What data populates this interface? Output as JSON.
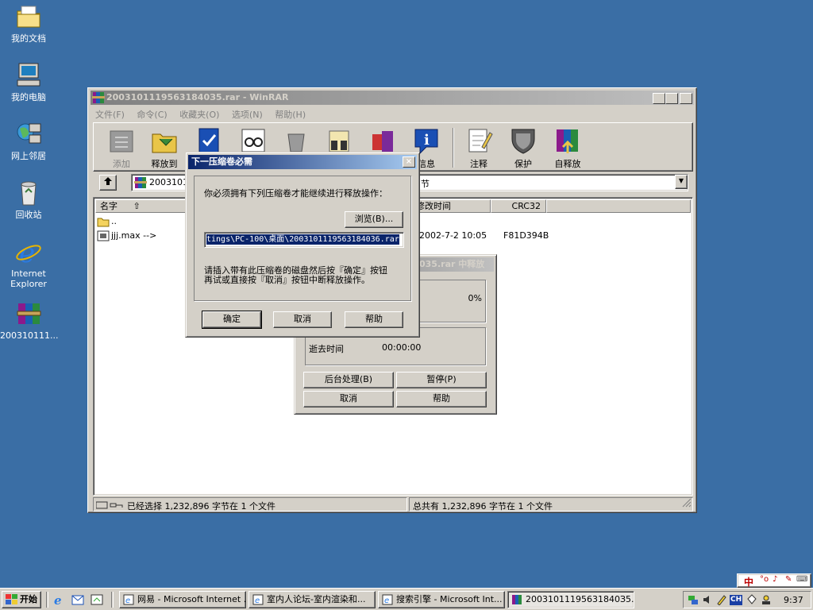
{
  "desktop": {
    "icons": [
      {
        "label": "我的文档",
        "icon": "my-documents-folder"
      },
      {
        "label": "我的电脑",
        "icon": "my-computer"
      },
      {
        "label": "网上邻居",
        "icon": "network-neighborhood"
      },
      {
        "label": "回收站",
        "icon": "recycle-bin"
      },
      {
        "label": "Internet Explorer",
        "icon": "internet-explorer"
      },
      {
        "label": "200310111...",
        "icon": "winrar-archive"
      }
    ]
  },
  "winrar": {
    "title": "20031011195631840З5.rar - WinRAR",
    "menu": [
      "文件(F)",
      "命令(C)",
      "收藏夹(O)",
      "选项(N)",
      "帮助(H)"
    ],
    "toolbar": [
      {
        "label": "添加",
        "icon": "add-icon"
      },
      {
        "label": "释放到",
        "icon": "extract-to-icon"
      },
      {
        "label": "",
        "icon": "test-icon"
      },
      {
        "label": "",
        "icon": "view-icon"
      },
      {
        "label": "",
        "icon": "delete-icon"
      },
      {
        "label": "",
        "icon": "find-icon"
      },
      {
        "label": "",
        "icon": "wizard-icon"
      },
      {
        "label": "信息",
        "icon": "info-icon"
      },
      {
        "label": "注释",
        "icon": "comment-icon"
      },
      {
        "label": "保护",
        "icon": "protect-icon"
      },
      {
        "label": "自释放",
        "icon": "sfx-icon"
      }
    ],
    "address": {
      "path_left": "2003101",
      "path_right": "节"
    },
    "columns": {
      "name": "名字",
      "modified": "修改时间",
      "crc": "CRC32"
    },
    "files": [
      {
        "name": "..",
        "modified": "",
        "crc": ""
      },
      {
        "name": "jjj.max -->",
        "modified": "2002-7-2 10:05",
        "crc": "F81D394B"
      }
    ],
    "status_left": "已经选择 1,232,896 字节在 1 个文件",
    "status_right": "总共有 1,232,896 字节在 1 个文件"
  },
  "progress_dialog": {
    "title_fragment": "035.rar 中释放",
    "percent": "0%",
    "elapsed_label": "逝去时间",
    "elapsed_value": "00:00:00",
    "buttons": {
      "background": "后台处理(B)",
      "pause": "暂停(P)",
      "cancel": "取消",
      "help": "帮助"
    }
  },
  "next_volume_dialog": {
    "title": "下一压缩卷必需",
    "message": "你必须拥有下列压缩卷才能继续进行释放操作：",
    "browse": "浏览(B)...",
    "path_value": "tings\\PC-100\\桌面\\20031011195631840З6.rar",
    "instruction_line1": "请插入带有此压缩卷的磁盘然后按『确定』按钮",
    "instruction_line2": "再试或直接按『取消』按钮中断释放操作。",
    "ok": "确定",
    "cancel": "取消",
    "help": "帮助"
  },
  "taskbar": {
    "start": "开始",
    "tasks": [
      "网易 - Microsoft Internet ...",
      "室内人论坛-室内渲染和...",
      "搜索引擎 - Microsoft Int...",
      "20031011195631840З5.r..."
    ],
    "clock": "9:37",
    "ime": "CH"
  }
}
